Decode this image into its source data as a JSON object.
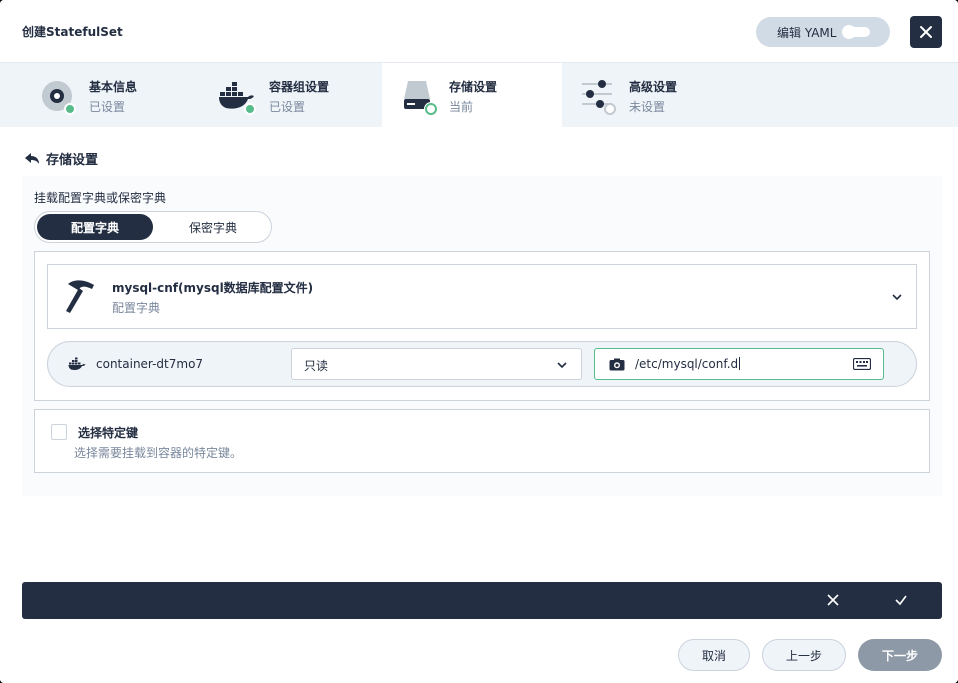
{
  "header": {
    "title": "创建StatefulSet",
    "yaml_label": "编辑 YAML"
  },
  "steps": [
    {
      "name": "基本信息",
      "status": "已设置"
    },
    {
      "name": "容器组设置",
      "status": "已设置"
    },
    {
      "name": "存储设置",
      "status": "当前"
    },
    {
      "name": "高级设置",
      "status": "未设置"
    }
  ],
  "section": {
    "title": "存储设置"
  },
  "mount": {
    "label": "挂载配置字典或保密字典",
    "tabs": [
      "配置字典",
      "保密字典"
    ],
    "selected_tab": "配置字典",
    "config": {
      "name": "mysql-cnf(mysql数据库配置文件)",
      "type": "配置字典"
    },
    "container": {
      "name": "container-dt7mo7",
      "access_mode": "只读",
      "mount_path": "/etc/mysql/conf.d"
    },
    "specific_keys": {
      "label": "选择特定键",
      "description": "选择需要挂载到容器的特定键。",
      "checked": false
    }
  },
  "footer": {
    "cancel": "取消",
    "previous": "上一步",
    "next": "下一步"
  },
  "colors": {
    "dark": "#242e42",
    "success": "#55bc8a",
    "muted": "#79879c"
  }
}
